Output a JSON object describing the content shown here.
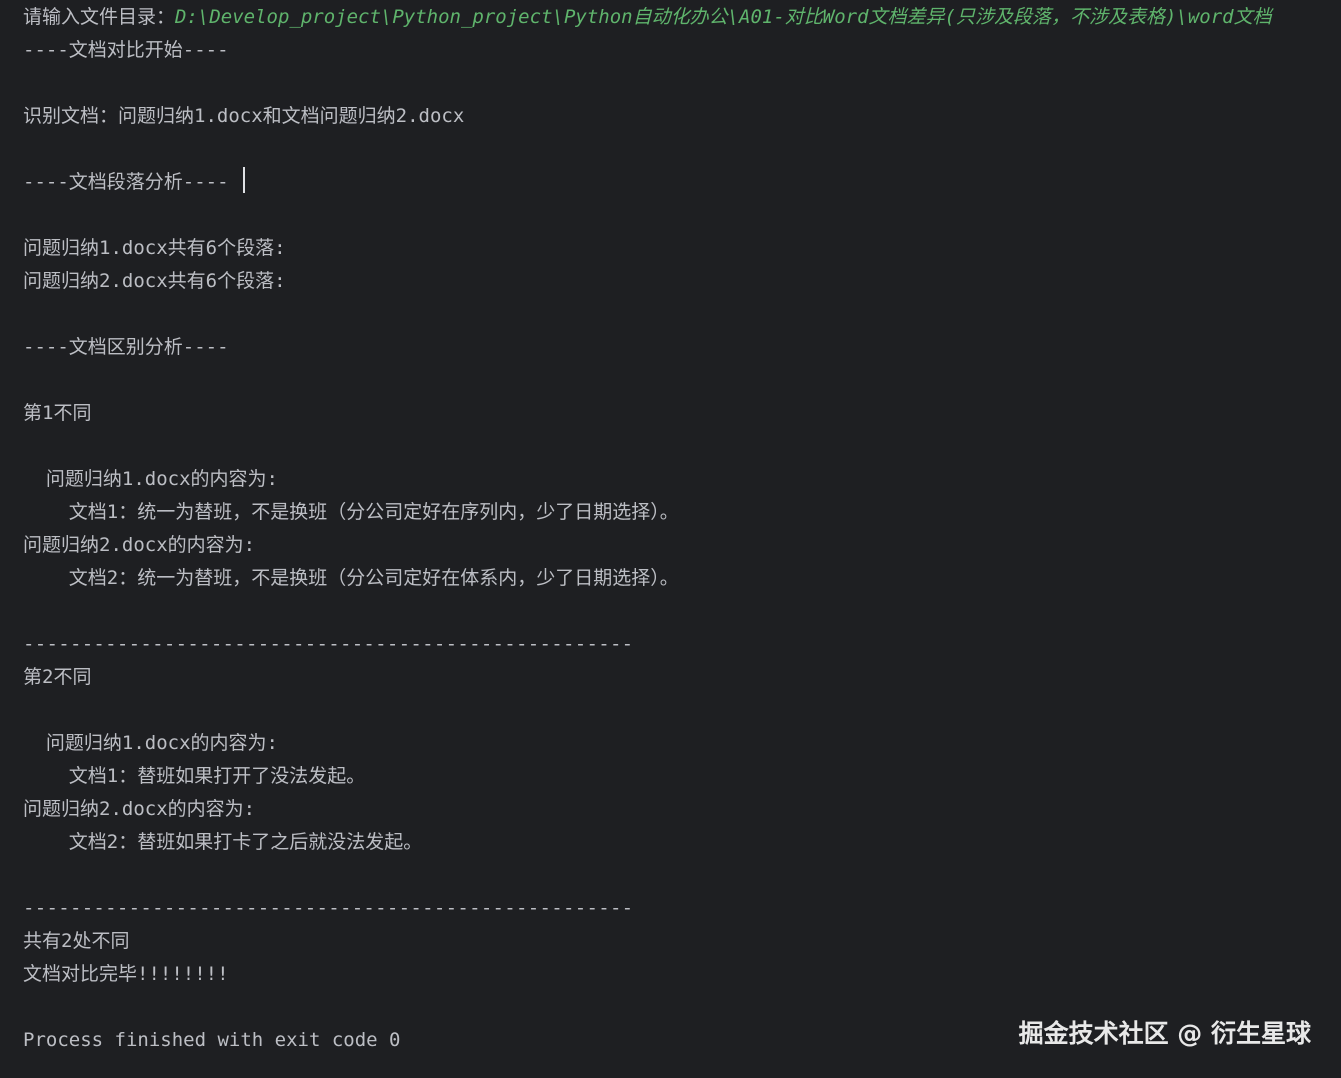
{
  "console": {
    "prompt": {
      "label": "请输入文件目录：",
      "input": "D:\\Develop_project\\Python_project\\Python自动化办公\\A01-对比Word文档差异(只涉及段落，不涉及表格)\\word文档"
    },
    "lines": [
      "----文档对比开始----",
      "识别文档：问题归纳1.docx和文档问题归纳2.docx",
      "----文档段落分析----",
      "问题归纳1.docx共有6个段落:",
      "问题归纳2.docx共有6个段落:",
      "----文档区别分析----",
      "第1不同",
      "  问题归纳1.docx的内容为:",
      "    文档1：统一为替班，不是换班（分公司定好在序列内，少了日期选择）。",
      "问题归纳2.docx的内容为:",
      "    文档2：统一为替班，不是换班（分公司定好在体系内，少了日期选择）。",
      "----------------------------------------------------",
      "第2不同",
      "  问题归纳1.docx的内容为:",
      "    文档1：替班如果打开了没法发起。",
      "问题归纳2.docx的内容为:",
      "    文档2：替班如果打卡了之后就没法发起。",
      "----------------------------------------------------",
      "共有2处不同",
      "文档对比完毕!!!!!!!!",
      "Process finished with exit code 0"
    ]
  },
  "watermark": "掘金技术社区 @ 衍生星球",
  "colors": {
    "background": "#1e1f22",
    "text": "#bcbec4",
    "input": "#5fb46c"
  }
}
